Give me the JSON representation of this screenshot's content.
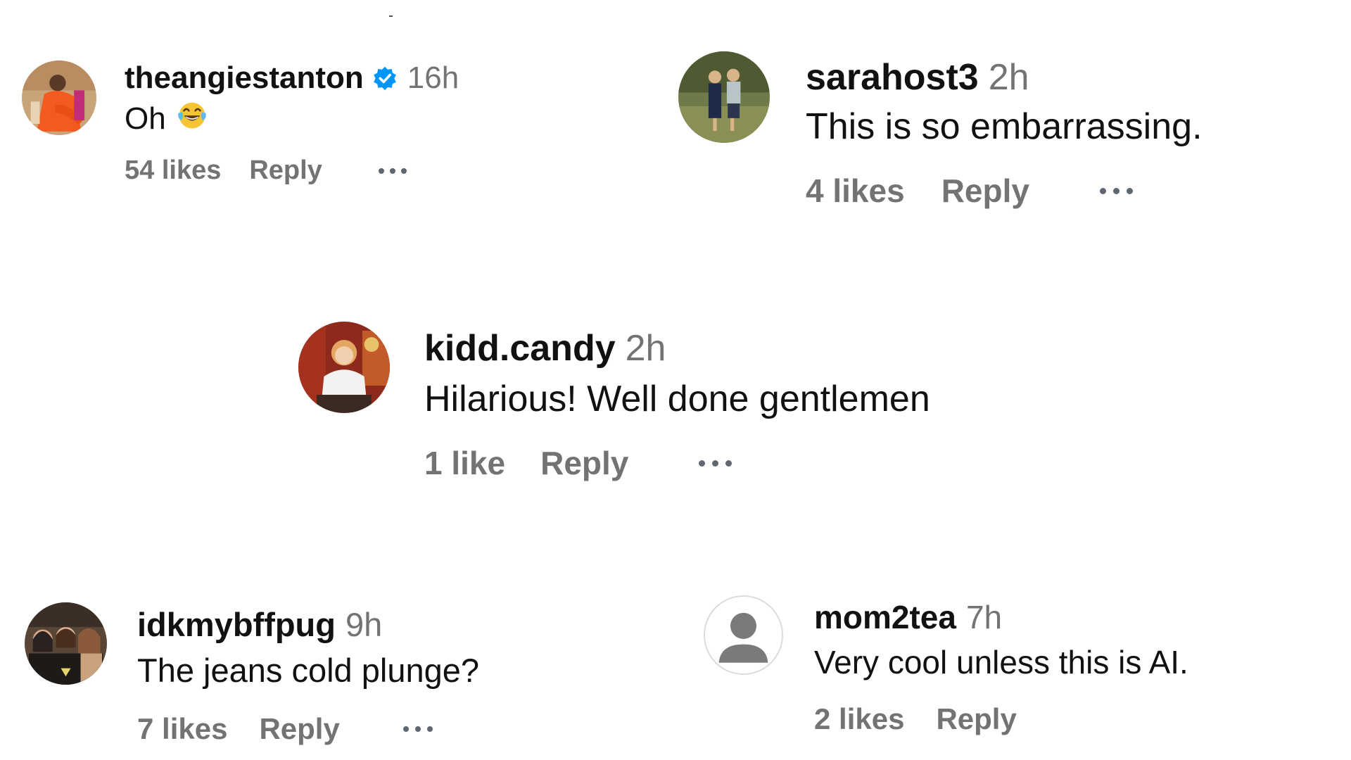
{
  "comments": [
    {
      "username": "theangiestanton",
      "verified": true,
      "time": "16h",
      "text": "Oh",
      "emoji": "face-with-tears-of-joy",
      "likes": "54 likes",
      "reply": "Reply",
      "avatar_icon": "profile-photo-woman-orange-dress"
    },
    {
      "username": "sarahost3",
      "verified": false,
      "time": "2h",
      "text": "This is so embarrassing.",
      "likes": "4 likes",
      "reply": "Reply",
      "avatar_icon": "profile-photo-couple-outdoors"
    },
    {
      "username": "kidd.candy",
      "verified": false,
      "time": "2h",
      "text": "Hilarious! Well done gentlemen",
      "likes": "1 like",
      "reply": "Reply",
      "avatar_icon": "profile-photo-woman-red-room"
    },
    {
      "username": "idkmybffpug",
      "verified": false,
      "time": "9h",
      "text": "The jeans cold plunge?",
      "likes": "7 likes",
      "reply": "Reply",
      "avatar_icon": "profile-photo-group-friends"
    },
    {
      "username": "mom2tea",
      "verified": false,
      "time": "7h",
      "text": "Very cool unless this is AI.",
      "likes": "2 likes",
      "reply": "Reply",
      "avatar_icon": "default-avatar-icon"
    }
  ],
  "colors": {
    "text_primary": "#111111",
    "text_secondary": "#737373",
    "verified_badge": "#0095f6",
    "background": "#ffffff"
  }
}
